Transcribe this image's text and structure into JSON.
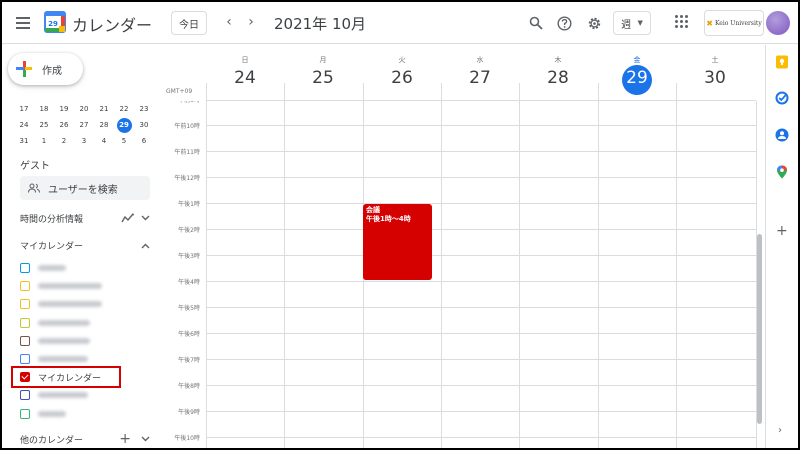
{
  "header": {
    "app_title": "カレンダー",
    "logo_day": "29",
    "today_label": "今日",
    "date_label": "2021年 10月",
    "view_label": "週",
    "org_name": "Keio University"
  },
  "sidebar": {
    "create_label": "作成",
    "mini_calendar": [
      [
        "17",
        "18",
        "19",
        "20",
        "21",
        "22",
        "23"
      ],
      [
        "24",
        "25",
        "26",
        "27",
        "28",
        "29",
        "30"
      ],
      [
        "31",
        "1",
        "2",
        "3",
        "4",
        "5",
        "6"
      ]
    ],
    "mini_today": "29",
    "guest_title": "ゲスト",
    "guest_search_placeholder": "ユーザーを検索",
    "analytics_label": "時間の分析情報",
    "my_calendars_title": "マイカレンダー",
    "calendars": [
      {
        "label": "",
        "color": "#039be5",
        "checked": false,
        "blurred": true,
        "w": 28
      },
      {
        "label": "",
        "color": "#f6bf26",
        "checked": false,
        "blurred": true,
        "w": 64
      },
      {
        "label": "",
        "color": "#f6bf26",
        "checked": false,
        "blurred": true,
        "w": 64
      },
      {
        "label": "",
        "color": "#c0ca33",
        "checked": false,
        "blurred": true,
        "w": 52
      },
      {
        "label": "",
        "color": "#795548",
        "checked": false,
        "blurred": true,
        "w": 52
      },
      {
        "label": "",
        "color": "#4285f4",
        "checked": false,
        "blurred": true,
        "w": 50
      },
      {
        "label": "マイカレンダー",
        "color": "#d50000",
        "checked": true,
        "blurred": false,
        "w": 0
      },
      {
        "label": "",
        "color": "#3f51b5",
        "checked": false,
        "blurred": true,
        "w": 50
      },
      {
        "label": "",
        "color": "#33b679",
        "checked": false,
        "blurred": true,
        "w": 28
      }
    ],
    "other_calendars_title": "他のカレンダー"
  },
  "week": {
    "timezone": "GMT+09",
    "days": [
      {
        "dow": "日",
        "num": "24",
        "today": false
      },
      {
        "dow": "月",
        "num": "25",
        "today": false
      },
      {
        "dow": "火",
        "num": "26",
        "today": false
      },
      {
        "dow": "水",
        "num": "27",
        "today": false
      },
      {
        "dow": "木",
        "num": "28",
        "today": false
      },
      {
        "dow": "金",
        "num": "29",
        "today": true
      },
      {
        "dow": "土",
        "num": "30",
        "today": false
      }
    ],
    "hours": [
      "午前9時",
      "午前10時",
      "午前11時",
      "午後12時",
      "午後1時",
      "午後2時",
      "午後3時",
      "午後4時",
      "午後5時",
      "午後6時",
      "午後7時",
      "午後8時",
      "午後9時",
      "午後10時"
    ],
    "event": {
      "title": "会議",
      "time": "午後1時～4時",
      "color": "#d50000",
      "day": "火"
    }
  }
}
